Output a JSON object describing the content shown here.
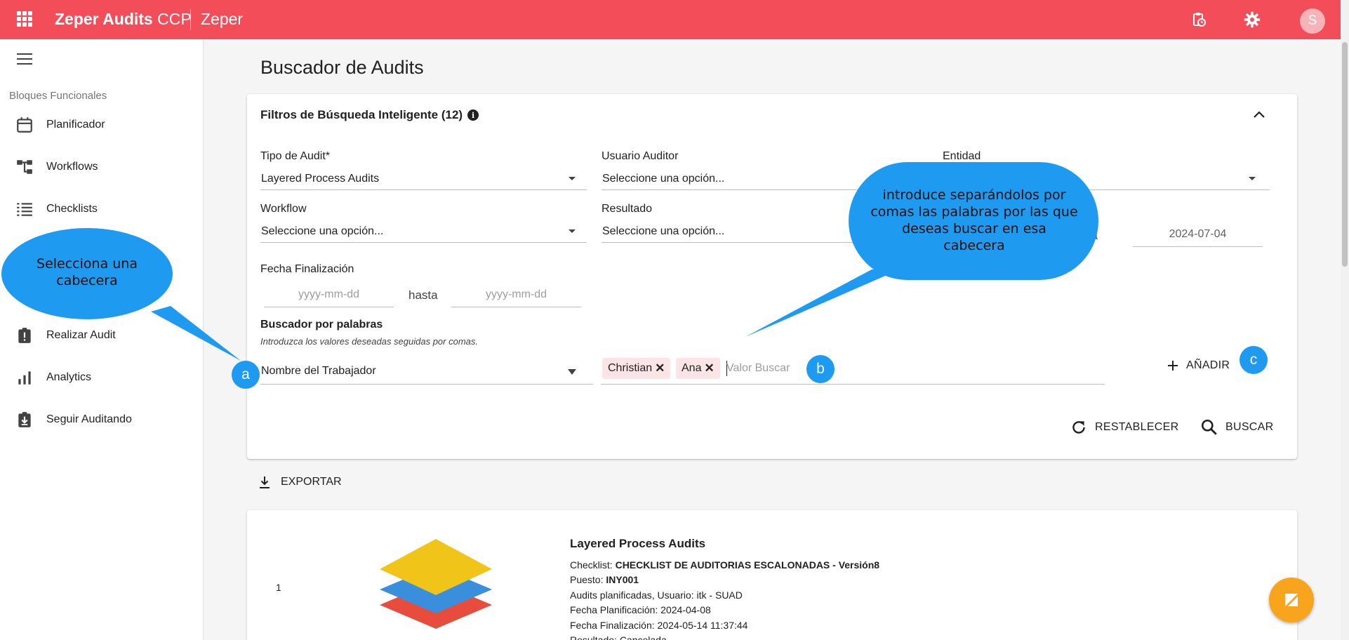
{
  "topbar": {
    "app_title_bold": "Zeper Audits",
    "app_title_light": "CCP",
    "org_name": "Zeper",
    "avatar_letter": "S"
  },
  "sidebar": {
    "section": "Bloques Funcionales",
    "items": [
      {
        "label": "Planificador",
        "icon": "calendar-icon"
      },
      {
        "label": "Workflows",
        "icon": "workflow-icon"
      },
      {
        "label": "Checklists",
        "icon": "checklist-icon"
      },
      {
        "label": "Realizar Audit",
        "icon": "clipboard-alert-icon"
      },
      {
        "label": "Analytics",
        "icon": "bar-chart-icon"
      },
      {
        "label": "Seguir Auditando",
        "icon": "clipboard-download-icon"
      }
    ]
  },
  "page": {
    "title": "Buscador de Audits"
  },
  "filters": {
    "title": "Filtros de Búsqueda Inteligente (12)",
    "tipo_label": "Tipo de Audit*",
    "tipo_value": "Layered Process Audits",
    "usuario_label": "Usuario Auditor",
    "usuario_value": "Seleccione una opción...",
    "entidad_label": "Entidad",
    "workflow_label": "Workflow",
    "workflow_value": "Seleccione una opción...",
    "resultado_label": "Resultado",
    "resultado_value": "Seleccione una opción...",
    "hasta_partial": "hasta",
    "plan_to_date": "2024-07-04",
    "fin_label": "Fecha Finalización",
    "date_placeholder": "yyyy-mm-dd",
    "hasta": "hasta",
    "kw_label": "Buscador por palabras",
    "kw_hint": "Introduzca los valores deseadas seguidas por comas.",
    "kw_header_value": "Nombre del Trabajador",
    "chips": [
      "Christian",
      "Ana"
    ],
    "chip_close": "✕",
    "kw_placeholder": "Valor Buscar",
    "add_label": "AÑADIR",
    "reset_label": "RESTABLECER",
    "search_label": "BUSCAR"
  },
  "export_label": "EXPORTAR",
  "result": {
    "index": "1",
    "title": "Layered Process Audits",
    "checklist_label": "Checklist:",
    "checklist_value": "CHECKLIST DE AUDITORIAS ESCALONADAS - Versión8",
    "puesto_label": "Puesto:",
    "puesto_value": "INY001",
    "planned_line": "Audits planificadas, Usuario: itk - SUAD",
    "plan_date_line": "Fecha Planificación: 2024-04-08",
    "fin_date_line": "Fecha Finalización: 2024-05-14 11:37:44",
    "result_line": "Resultado: Cancelada",
    "layer_colors": [
      "#f0c419",
      "#3a8fdc",
      "#e74c3c"
    ]
  },
  "callouts": {
    "left_text": "Selecciona una cabecera",
    "right_text": "introduce separándolos por comas las palabras por las que deseas buscar en esa cabecera",
    "badge_a": "a",
    "badge_b": "b",
    "badge_c": "c"
  },
  "colors": {
    "brand": "#f44d5a",
    "callout": "#1e9bf0",
    "chip": "#fde4e7",
    "fab": "#f8a41c"
  }
}
